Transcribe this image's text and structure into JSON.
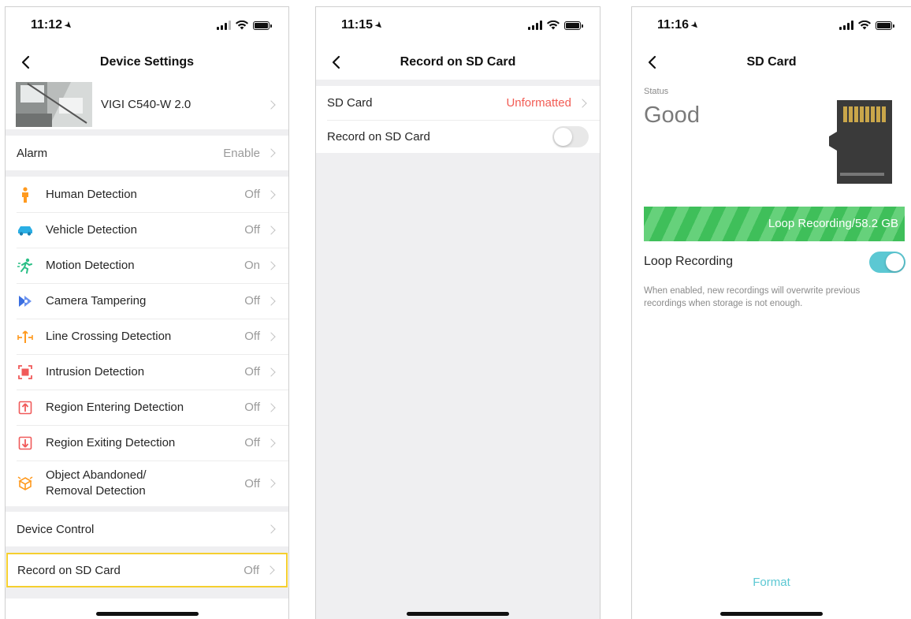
{
  "screens": {
    "device_settings": {
      "time": "11:12",
      "title": "Device Settings",
      "camera_name": "VIGI C540-W 2.0",
      "alarm": {
        "label": "Alarm",
        "value": "Enable"
      },
      "detections": [
        {
          "label": "Human Detection",
          "value": "Off",
          "icon": "human-icon"
        },
        {
          "label": "Vehicle Detection",
          "value": "Off",
          "icon": "vehicle-icon"
        },
        {
          "label": "Motion Detection",
          "value": "On",
          "icon": "motion-icon"
        },
        {
          "label": "Camera Tampering",
          "value": "Off",
          "icon": "tampering-icon"
        },
        {
          "label": "Line Crossing Detection",
          "value": "Off",
          "icon": "line-crossing-icon"
        },
        {
          "label": "Intrusion Detection",
          "value": "Off",
          "icon": "intrusion-icon"
        },
        {
          "label": "Region Entering Detection",
          "value": "Off",
          "icon": "region-entering-icon"
        },
        {
          "label": "Region Exiting Detection",
          "value": "Off",
          "icon": "region-exiting-icon"
        },
        {
          "label_line1": "Object Abandoned/",
          "label_line2": "Removal Detection",
          "value": "Off",
          "icon": "object-abandoned-icon"
        }
      ],
      "device_control": {
        "label": "Device Control"
      },
      "record_sd": {
        "label": "Record on SD Card",
        "value": "Off"
      },
      "highlight_color": "#f5cf2f"
    },
    "record_on_sd": {
      "time": "11:15",
      "title": "Record on SD Card",
      "sd_card": {
        "label": "SD Card",
        "value": "Unformatted",
        "value_color": "#f25c54"
      },
      "record": {
        "label": "Record on SD Card",
        "enabled": false
      }
    },
    "sd_card": {
      "time": "11:16",
      "title": "SD Card",
      "status_label": "Status",
      "status_value": "Good",
      "storage_bar_text": "Loop Recording/58.2 GB",
      "storage_bar_color": "#3fbf5a",
      "loop": {
        "label": "Loop Recording",
        "enabled": true
      },
      "loop_help": "When enabled, new recordings will overwrite previous recordings when storage is not enough.",
      "format_label": "Format",
      "accent_color": "#5cc8d3"
    }
  }
}
